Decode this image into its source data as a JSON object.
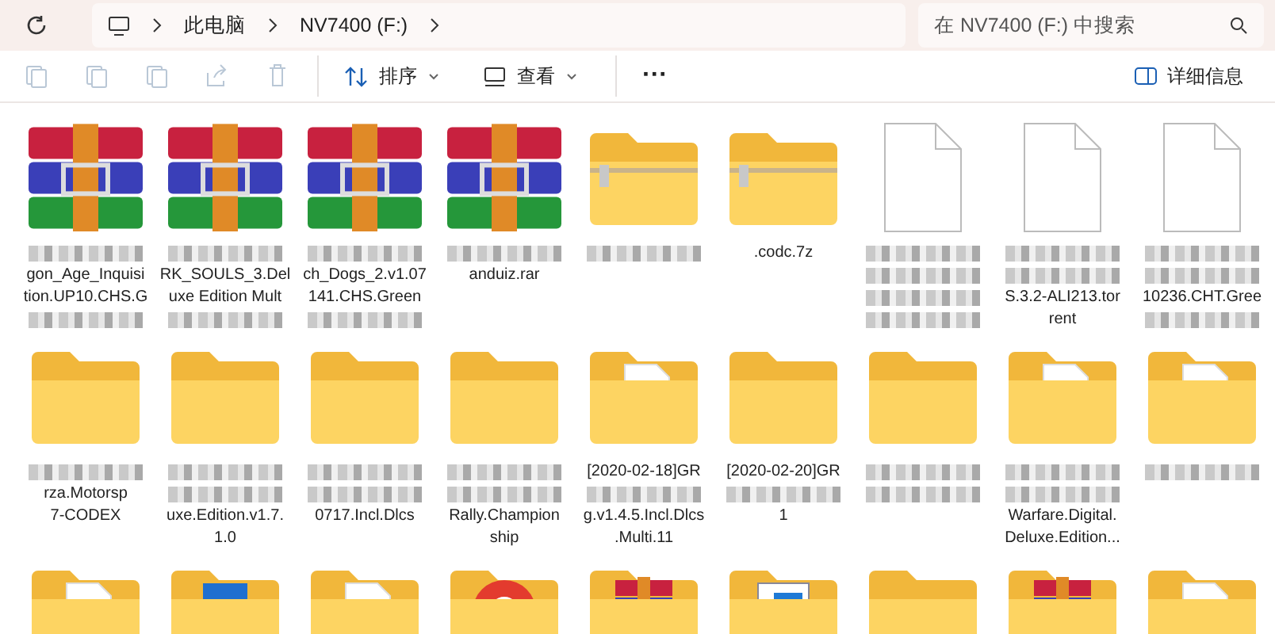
{
  "address_bar": {
    "segments": [
      "此电脑",
      "NV7400 (F:)"
    ]
  },
  "search": {
    "placeholder": "在 NV7400 (F:) 中搜索"
  },
  "toolbar": {
    "sort_label": "排序",
    "view_label": "查看",
    "more": "···",
    "details_label": "详细信息"
  },
  "items": [
    {
      "kind": "rar",
      "lines": [
        {
          "kind": "mosaic"
        },
        {
          "kind": "text",
          "text": "gon_Age_Inquisi"
        },
        {
          "kind": "text",
          "text": "tion.UP10.CHS.G"
        },
        {
          "kind": "mosaic"
        }
      ]
    },
    {
      "kind": "rar",
      "lines": [
        {
          "kind": "mosaic"
        },
        {
          "kind": "text",
          "text": "RK_SOULS_3.Del"
        },
        {
          "kind": "text",
          "text": "uxe Edition Mult"
        },
        {
          "kind": "mosaic"
        }
      ]
    },
    {
      "kind": "rar",
      "lines": [
        {
          "kind": "mosaic"
        },
        {
          "kind": "text",
          "text": "ch_Dogs_2.v1.07"
        },
        {
          "kind": "text",
          "text": "141.CHS.Green"
        },
        {
          "kind": "mosaic"
        }
      ]
    },
    {
      "kind": "rar",
      "lines": [
        {
          "kind": "mosaic"
        },
        {
          "kind": "text",
          "text": "anduiz.rar"
        }
      ]
    },
    {
      "kind": "zip",
      "lines": [
        {
          "kind": "mosaic"
        }
      ]
    },
    {
      "kind": "zip",
      "lines": [
        {
          "kind": "text",
          "text": ".codc.7z"
        }
      ]
    },
    {
      "kind": "file",
      "lines": [
        {
          "kind": "mosaic"
        },
        {
          "kind": "mosaic"
        },
        {
          "kind": "mosaic"
        },
        {
          "kind": "mosaic"
        }
      ]
    },
    {
      "kind": "file",
      "lines": [
        {
          "kind": "mosaic"
        },
        {
          "kind": "mosaic"
        },
        {
          "kind": "text",
          "text": "S.3.2-ALI213.tor"
        },
        {
          "kind": "text",
          "text": "rent"
        }
      ]
    },
    {
      "kind": "file",
      "lines": [
        {
          "kind": "mosaic"
        },
        {
          "kind": "mosaic"
        },
        {
          "kind": "text",
          "text": "10236.CHT.Gree"
        },
        {
          "kind": "mosaic"
        }
      ]
    },
    {
      "kind": "folder",
      "lines": [
        {
          "kind": "mosaic"
        },
        {
          "kind": "text",
          "text": "rza.Motorsp"
        },
        {
          "kind": "text",
          "text": "7-CODEX"
        }
      ]
    },
    {
      "kind": "folder",
      "lines": [
        {
          "kind": "mosaic"
        },
        {
          "kind": "mosaic"
        },
        {
          "kind": "text",
          "text": "uxe.Edition.v1.7."
        },
        {
          "kind": "text",
          "text": "1.0"
        }
      ]
    },
    {
      "kind": "folder",
      "lines": [
        {
          "kind": "mosaic"
        },
        {
          "kind": "mosaic"
        },
        {
          "kind": "text",
          "text": "0717.Incl.Dlcs"
        }
      ]
    },
    {
      "kind": "folder",
      "lines": [
        {
          "kind": "mosaic"
        },
        {
          "kind": "mosaic"
        },
        {
          "kind": "text",
          "text": "Rally.Champion"
        },
        {
          "kind": "text",
          "text": "ship"
        }
      ]
    },
    {
      "kind": "folder-doc",
      "lines": [
        {
          "kind": "text",
          "text": "[2020-02-18]GR"
        },
        {
          "kind": "mosaic"
        },
        {
          "kind": "text",
          "text": "g.v1.4.5.Incl.Dlcs"
        },
        {
          "kind": "text",
          "text": ".Multi.11"
        }
      ]
    },
    {
      "kind": "folder",
      "lines": [
        {
          "kind": "text",
          "text": "[2020-02-20]GR"
        },
        {
          "kind": "mosaic"
        },
        {
          "kind": "text",
          "text": "1"
        }
      ]
    },
    {
      "kind": "folder",
      "lines": [
        {
          "kind": "mosaic"
        },
        {
          "kind": "mosaic"
        }
      ]
    },
    {
      "kind": "folder-doc",
      "lines": [
        {
          "kind": "mosaic"
        },
        {
          "kind": "mosaic"
        },
        {
          "kind": "text",
          "text": "Warfare.Digital."
        },
        {
          "kind": "text",
          "text": "Deluxe.Edition..."
        }
      ]
    },
    {
      "kind": "folder-doc",
      "lines": [
        {
          "kind": "mosaic"
        }
      ]
    },
    {
      "kind": "folder-doc"
    },
    {
      "kind": "folder-image"
    },
    {
      "kind": "folder-doc"
    },
    {
      "kind": "folder-chrome"
    },
    {
      "kind": "folder-rar"
    },
    {
      "kind": "folder-window"
    },
    {
      "kind": "folder"
    },
    {
      "kind": "folder-rar"
    },
    {
      "kind": "folder-doc"
    }
  ]
}
